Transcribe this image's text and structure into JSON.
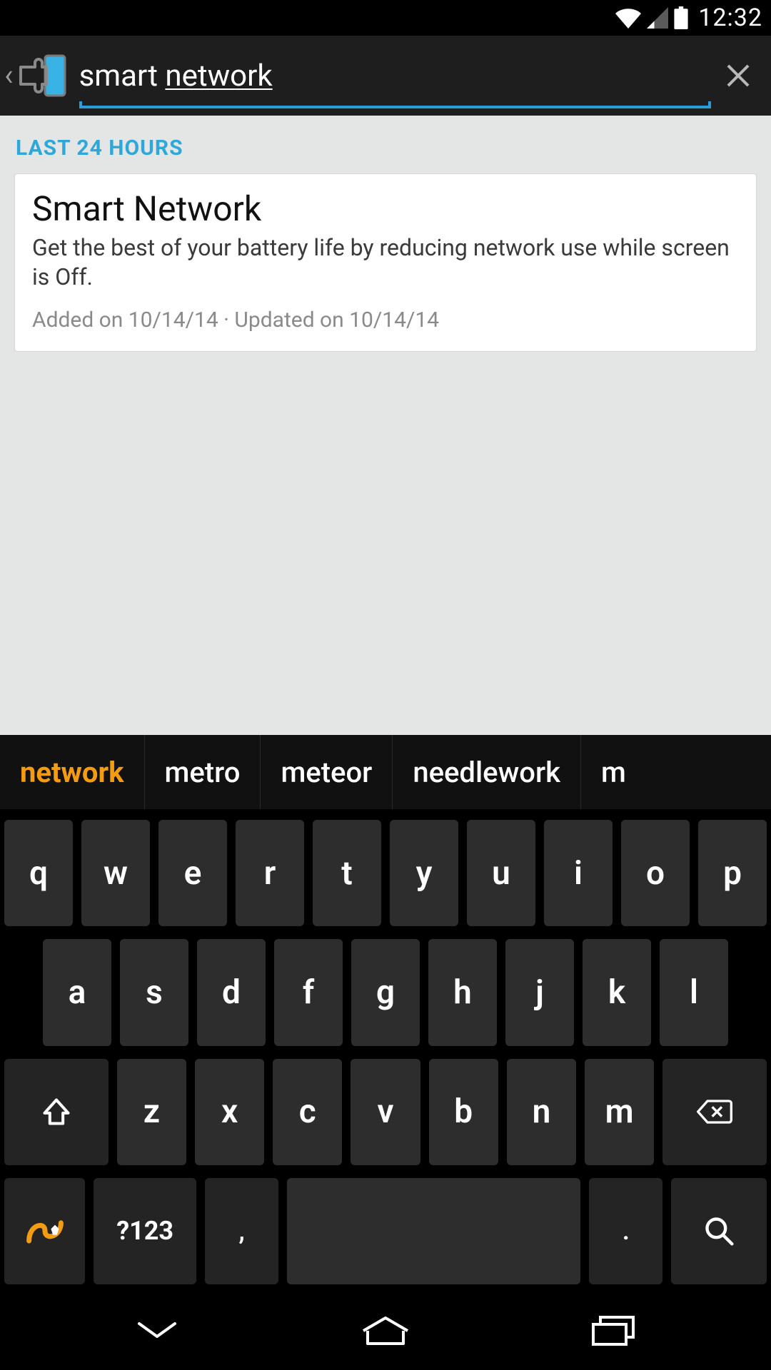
{
  "status": {
    "time": "12:32"
  },
  "search": {
    "value_prefix": "smart ",
    "value_suffix": "network"
  },
  "section_header": "LAST 24 HOURS",
  "result": {
    "title": "Smart Network",
    "desc": "Get the best of your battery life by reducing network use while screen is Off.",
    "meta": "Added on 10/14/14 · Updated on 10/14/14"
  },
  "suggestions": [
    "network",
    "metro",
    "meteor",
    "needlework",
    "m"
  ],
  "keyboard": {
    "row1": [
      "q",
      "w",
      "e",
      "r",
      "t",
      "y",
      "u",
      "i",
      "o",
      "p"
    ],
    "row2": [
      "a",
      "s",
      "d",
      "f",
      "g",
      "h",
      "j",
      "k",
      "l"
    ],
    "row3": [
      "z",
      "x",
      "c",
      "v",
      "b",
      "n",
      "m"
    ],
    "sym_label": "?123",
    "comma": ",",
    "period": "."
  }
}
